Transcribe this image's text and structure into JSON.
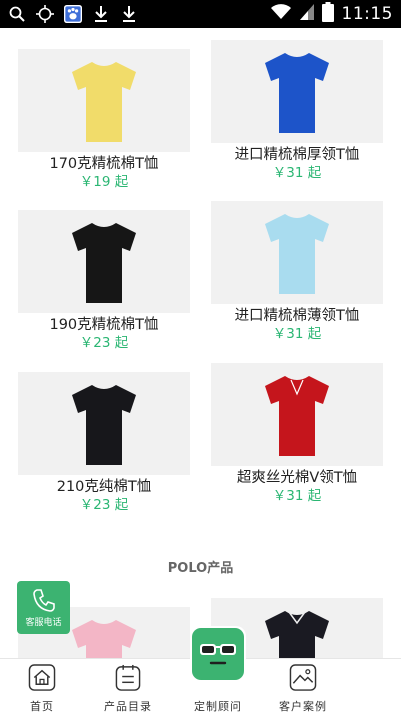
{
  "status_bar": {
    "time": "11:15"
  },
  "products": [
    {
      "name": "170克精梳棉T恤",
      "price": "￥19 起",
      "color": "#f1dc6a"
    },
    {
      "name": "进口精梳棉厚领T恤",
      "price": "￥31 起",
      "color": "#1d54c9"
    },
    {
      "name": "190克精梳棉T恤",
      "price": "￥23 起",
      "color": "#161616"
    },
    {
      "name": "进口精梳棉薄领T恤",
      "price": "￥31 起",
      "color": "#a9dcef"
    },
    {
      "name": "210克纯棉T恤",
      "price": "￥23 起",
      "color": "#17171b"
    },
    {
      "name": "超爽丝光棉V领T恤",
      "price": "￥31 起",
      "color": "#c5151c"
    }
  ],
  "section": {
    "title": "POLO产品"
  },
  "polo_products": [
    {
      "color": "#f3b6c6"
    },
    {
      "color": "#1a1a22"
    }
  ],
  "fab": {
    "label": "客服电话"
  },
  "bottom_nav": {
    "home": "首页",
    "catalog": "产品目录",
    "consultant": "定制顾问",
    "cases": "客户案例"
  },
  "colors": {
    "accent": "#3cb371",
    "price": "#2bb673"
  }
}
